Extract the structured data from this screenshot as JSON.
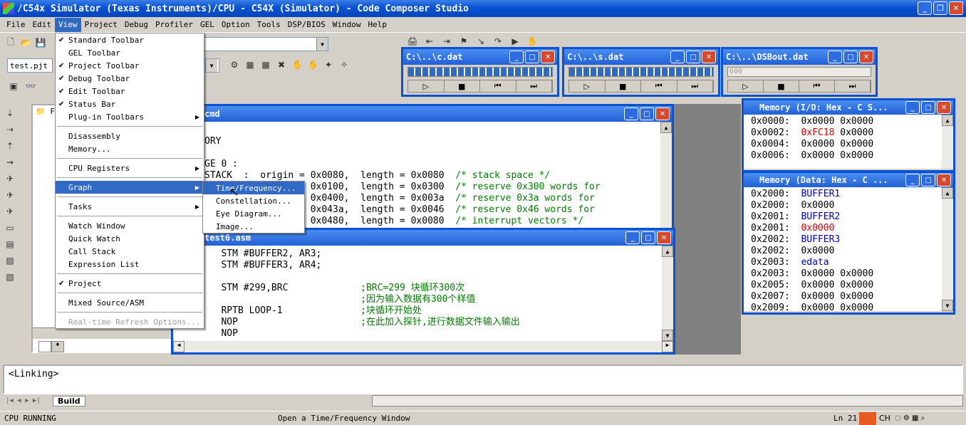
{
  "window": {
    "title": "/C54x Simulator (Texas Instruments)/CPU - C54X (Simulator) - Code Composer Studio"
  },
  "menubar": [
    "File",
    "Edit",
    "View",
    "Project",
    "Debug",
    "Profiler",
    "GEL",
    "Option",
    "Tools",
    "DSP/BIOS",
    "Window",
    "Help"
  ],
  "project_combo": "test.pjt",
  "view_menu": [
    {
      "label": "Standard Toolbar",
      "check": true
    },
    {
      "label": "GEL Toolbar",
      "check": false
    },
    {
      "label": "Project Toolbar",
      "check": true
    },
    {
      "label": "Debug Toolbar",
      "check": true
    },
    {
      "label": "Edit Toolbar",
      "check": true
    },
    {
      "label": "Status Bar",
      "check": true
    },
    {
      "label": "Plug-in Toolbars",
      "sub": true
    },
    {
      "sep": true
    },
    {
      "label": "Disassembly"
    },
    {
      "label": "Memory..."
    },
    {
      "sep": true
    },
    {
      "label": "CPU Registers",
      "sub": true
    },
    {
      "sep": true
    },
    {
      "label": "Graph",
      "sub": true,
      "hl": true
    },
    {
      "sep": true
    },
    {
      "label": "Tasks",
      "sub": true
    },
    {
      "sep": true
    },
    {
      "label": "Watch Window"
    },
    {
      "label": "Quick Watch"
    },
    {
      "label": "Call Stack"
    },
    {
      "label": "Expression List"
    },
    {
      "sep": true
    },
    {
      "label": "Project",
      "check": true
    },
    {
      "sep": true
    },
    {
      "label": "Mixed Source/ASM"
    },
    {
      "sep": true
    },
    {
      "label": "Real-time Refresh Options...",
      "dis": true
    }
  ],
  "graph_submenu": [
    "Time/Frequency...",
    "Constellation...",
    "Eye Diagram...",
    "Image..."
  ],
  "file_windows": [
    {
      "title": "C:\\..\\c.dat"
    },
    {
      "title": "C:\\..\\s.dat"
    },
    {
      "title": "C:\\..\\DSBout.dat",
      "value": "600"
    }
  ],
  "cmd_window": {
    "title": "cmd",
    "lines": [
      {
        "t": "",
        "c": ""
      },
      {
        "t": "ORY",
        "c": ""
      },
      {
        "t": "",
        "c": ""
      },
      {
        "t": "GE 0 :",
        "c": ""
      },
      {
        "t": "STACK  :  origin = 0x0080,  length = 0x0080  ",
        "c": "/* stack space */"
      },
      {
        "t": "       :  origin = 0x0100,  length = 0x0300  ",
        "c": "/* reserve 0x300 words for"
      },
      {
        "t": "       :  origin = 0x0400,  length = 0x003a  ",
        "c": "/* reserve 0x3a words for"
      },
      {
        "t": "       :  origin = 0x043a,  length = 0x0046  ",
        "c": "/* reserve 0x46 words for"
      },
      {
        "t": "       :  origin = 0x0480,  length = 0x0080  ",
        "c": "/* interrupt vectors */"
      }
    ]
  },
  "asm_window": {
    "title": "test6.asm",
    "lines": [
      {
        "t": "   STM #BUFFER2, AR3;",
        "c": ""
      },
      {
        "t": "   STM #BUFFER3, AR4;",
        "c": ""
      },
      {
        "t": "",
        "c": ""
      },
      {
        "t": "   STM #299,BRC             ",
        "c": ";BRC=299 块循环300次"
      },
      {
        "t": "                            ",
        "c": ";因为输入数据有300个样值"
      },
      {
        "t": "   RPTB LOOP-1              ",
        "c": ";块循环开始处"
      },
      {
        "t": "   NOP                      ",
        "c": ";在此加入探针,进行数据文件输入输出"
      },
      {
        "t": "   NOP",
        "c": ""
      }
    ]
  },
  "mem_io": {
    "title": "Memory (I/O: Hex - C S...",
    "rows": [
      {
        "a": "0x0000:",
        "v": [
          "0x0000",
          "0x0000"
        ],
        "red": -1
      },
      {
        "a": "0x0002:",
        "v": [
          "0xFC18",
          "0x0000"
        ],
        "red": 0
      },
      {
        "a": "0x0004:",
        "v": [
          "0x0000",
          "0x0000"
        ],
        "red": -1
      },
      {
        "a": "0x0006:",
        "v": [
          "0x0000",
          "0x0000"
        ],
        "red": -1
      }
    ]
  },
  "mem_data": {
    "title": "Memory (Data: Hex - C ...",
    "rows": [
      {
        "a": "0x2000:",
        "v": [
          "BUFFER1"
        ],
        "cls": "blue"
      },
      {
        "a": "0x2000:",
        "v": [
          "0x0000"
        ],
        "cls": ""
      },
      {
        "a": "0x2001:",
        "v": [
          "BUFFER2"
        ],
        "cls": "blue"
      },
      {
        "a": "0x2001:",
        "v": [
          "0x0000"
        ],
        "cls": "red"
      },
      {
        "a": "0x2002:",
        "v": [
          "BUFFER3"
        ],
        "cls": "blue"
      },
      {
        "a": "0x2002:",
        "v": [
          "0x0000"
        ],
        "cls": ""
      },
      {
        "a": "0x2003:",
        "v": [
          "edata"
        ],
        "cls": "blue"
      },
      {
        "a": "0x2003:",
        "v": [
          "0x0000",
          "0x0000"
        ],
        "cls": ""
      },
      {
        "a": "0x2005:",
        "v": [
          "0x0000",
          "0x0000"
        ],
        "cls": ""
      },
      {
        "a": "0x2007:",
        "v": [
          "0x0000",
          "0x0000"
        ],
        "cls": ""
      },
      {
        "a": "0x2009:",
        "v": [
          "0x0000",
          "0x0000"
        ],
        "cls": ""
      }
    ]
  },
  "tree": {
    "root": "Fi"
  },
  "output": {
    "text": "<Linking>",
    "tab": "Build"
  },
  "status": {
    "left": "CPU RUNNING",
    "middle": "Open a Time/Frequency Window",
    "right": "Ln 21",
    "ime": "CH"
  }
}
